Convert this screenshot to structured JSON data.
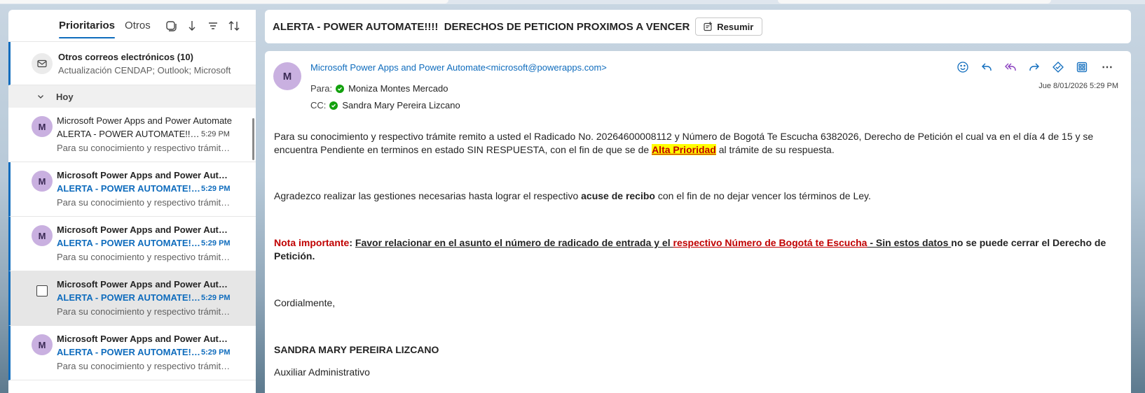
{
  "list": {
    "tabs": {
      "focused": "Prioritarios",
      "other": "Otros"
    },
    "other_mail": {
      "title": "Otros correos electrónicos (10)",
      "preview": "Actualización CENDAP; Outlook; Microsoft"
    },
    "group": "Hoy",
    "messages": [
      {
        "avatar": "M",
        "sender": "Microsoft Power Apps and Power Automate",
        "subject": "ALERTA - POWER AUTOMATE!!!! DERECHOS DE PETICION",
        "time": "5:29 PM",
        "preview": "Para su conocimiento y respectivo trámite remito"
      },
      {
        "avatar": "M",
        "sender": "Microsoft Power Apps and Power Automate",
        "subject": "ALERTA - POWER AUTOMATE!!!! DERECHOS DE PETICION",
        "time": "5:29 PM",
        "preview": "Para su conocimiento y respectivo trámite remito"
      },
      {
        "avatar": "M",
        "sender": "Microsoft Power Apps and Power Automate",
        "subject": "ALERTA - POWER AUTOMATE!!!! DERECHOS DE PETICION",
        "time": "5:29 PM",
        "preview": "Para su conocimiento y respectivo trámite remito"
      },
      {
        "avatar": "",
        "sender": "Microsoft Power Apps and Power Automate",
        "subject": "ALERTA - POWER AUTOMATE!!!! DERECHOS DE PETICION",
        "time": "5:29 PM",
        "preview": "Para su conocimiento y respectivo trámite remito"
      },
      {
        "avatar": "M",
        "sender": "Microsoft Power Apps and Power Automate",
        "subject": "ALERTA - POWER AUTOMATE!!!! DERECHOS DE PETICION",
        "time": "5:29 PM",
        "preview": "Para su conocimiento y respectivo trámite remito"
      }
    ]
  },
  "reading": {
    "subject": "ALERTA - POWER AUTOMATE!!!!  DERECHOS DE PETICION PROXIMOS A VENCER",
    "summarize_label": "Resumir",
    "avatar": "M",
    "from": "Microsoft Power Apps and Power Automate<microsoft@powerapps.com>",
    "to_label": "Para:",
    "to": "Moniza Montes Mercado",
    "cc_label": "CC:",
    "cc": "Sandra Mary Pereira Lizcano",
    "date": "Jue 8/01/2026 5:29 PM",
    "body": {
      "p1_a": "Para su conocimiento y respectivo trámite remito a usted el Radicado No. 20264600008112 y Número de Bogotá Te Escucha 6382026, Derecho de Petición el cual va en el día 4 de 15 y se encuentra Pendiente en terminos en estado SIN RESPUESTA, con el fin de que se de ",
      "p1_hl": "Alta Prioridad",
      "p1_b": " al trámite de su respuesta.",
      "p2_a": "Agradezco realizar las gestiones necesarias hasta lograr el respectivo ",
      "p2_b": "acuse de recibo",
      "p2_c": " con el fin de no dejar vencer los términos de Ley.",
      "p3_a": "Nota importante",
      "p3_b": ": ",
      "p3_c": "Favor relacionar en el asunto el número de radicado de entrada y el ",
      "p3_d": "respectivo Número de Bogotá te Escucha",
      "p3_e": " - Sin estos datos ",
      "p3_f": "no se puede cerrar el Derecho de Petición.",
      "p4": "Cordialmente,",
      "p5": "SANDRA MARY PEREIRA LIZCANO",
      "p6": "Auxiliar Administrativo"
    }
  },
  "colors": {
    "accent": "#0f6cbd",
    "avatar_bg": "#c9b0e0",
    "highlight": "#ffff00",
    "alert_red": "#c00000",
    "check_green": "#13a10e"
  }
}
